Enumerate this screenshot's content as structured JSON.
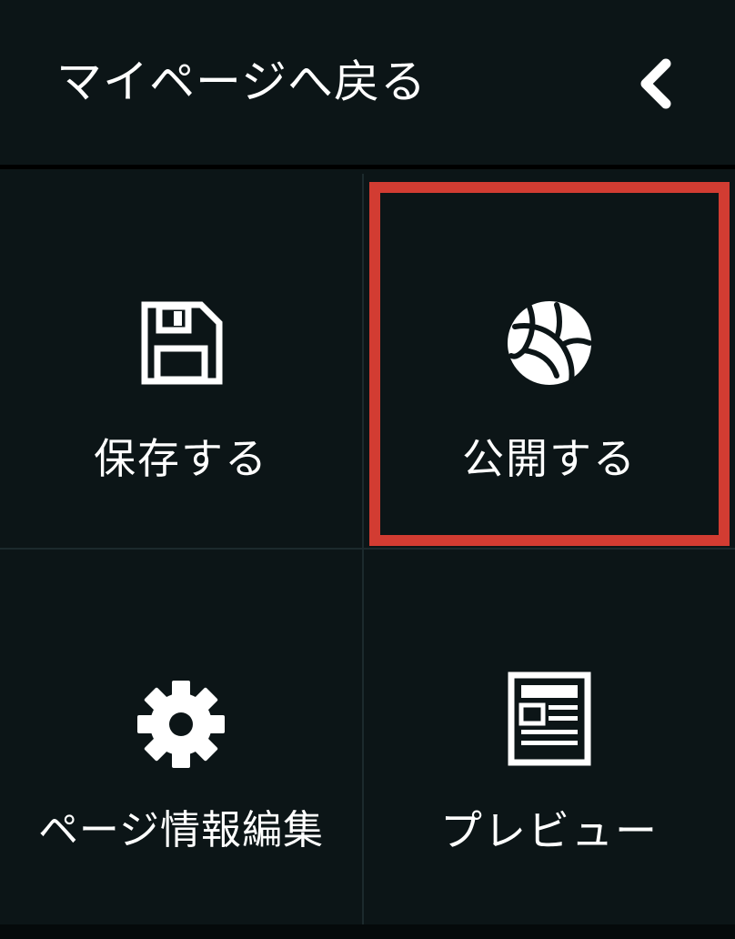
{
  "header": {
    "back_label": "マイページへ戻る",
    "back_icon": "chevron-left-icon"
  },
  "menu": {
    "save": {
      "label": "保存する",
      "icon": "floppy-disk-icon"
    },
    "publish": {
      "label": "公開する",
      "icon": "globe-icon"
    },
    "page_info": {
      "label": "ページ情報編集",
      "icon": "gear-icon"
    },
    "preview": {
      "label": "プレビュー",
      "icon": "document-icon"
    }
  },
  "colors": {
    "background": "#0c1517",
    "text": "#ffffff",
    "highlight": "#d23c32",
    "divider": "#1c2a2d"
  }
}
